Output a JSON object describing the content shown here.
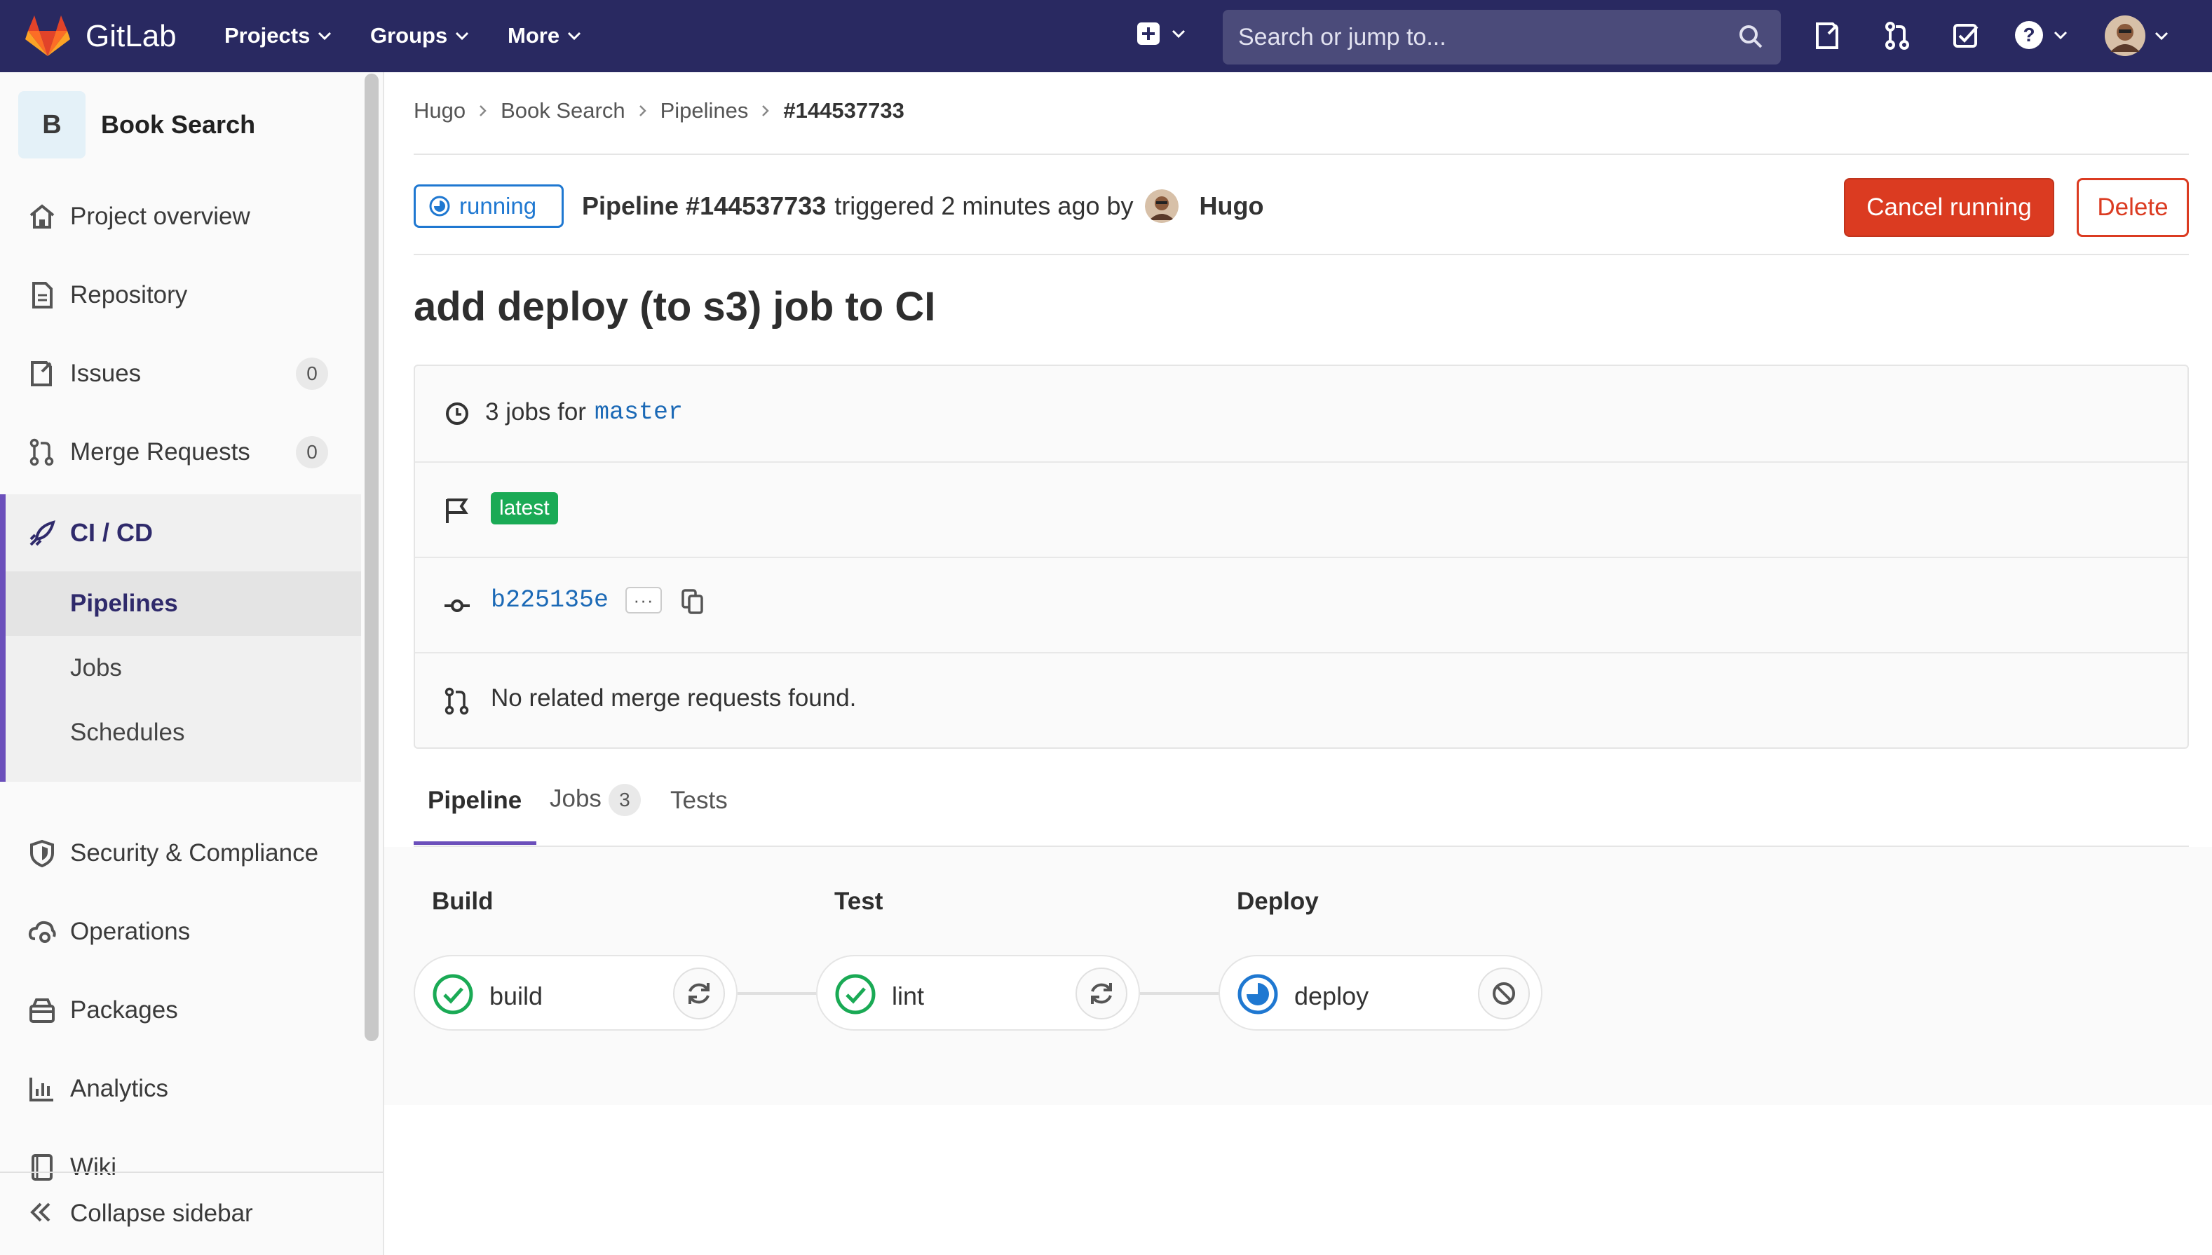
{
  "navbar": {
    "app_name": "GitLab",
    "menus": [
      "Projects",
      "Groups",
      "More"
    ],
    "search_placeholder": "Search or jump to...",
    "bg_color": "#292961"
  },
  "sidebar": {
    "project_initial": "B",
    "project_name": "Book Search",
    "items": [
      {
        "label": "Project overview",
        "icon": "home-icon"
      },
      {
        "label": "Repository",
        "icon": "document-icon"
      },
      {
        "label": "Issues",
        "icon": "issues-icon",
        "count": "0"
      },
      {
        "label": "Merge Requests",
        "icon": "merge-request-icon",
        "count": "0"
      },
      {
        "label": "CI / CD",
        "icon": "rocket-icon"
      },
      {
        "label": "Security & Compliance",
        "icon": "shield-icon"
      },
      {
        "label": "Operations",
        "icon": "cloud-gear-icon"
      },
      {
        "label": "Packages",
        "icon": "package-icon"
      },
      {
        "label": "Analytics",
        "icon": "chart-icon"
      },
      {
        "label": "Wiki",
        "icon": "book-icon"
      }
    ],
    "ci_sub": [
      "Pipelines",
      "Jobs",
      "Schedules"
    ],
    "collapse_label": "Collapse sidebar",
    "accent_color": "#6b4fbb"
  },
  "breadcrumb": [
    "Hugo",
    "Book Search",
    "Pipelines",
    "#144537733"
  ],
  "header": {
    "status": "running",
    "pipeline_label": "Pipeline #144537733",
    "triggered_text": "triggered 2 minutes ago by",
    "user": "Hugo",
    "cancel_label": "Cancel running",
    "delete_label": "Delete"
  },
  "commit_title": "add deploy (to s3) job to CI",
  "info": {
    "jobs_prefix": "3 jobs for",
    "branch": "master",
    "badge": "latest",
    "commit_sha": "b225135e",
    "ellipsis": "···",
    "merge_requests": "No related merge requests found."
  },
  "tabs": [
    {
      "label": "Pipeline"
    },
    {
      "label": "Jobs",
      "count": "3"
    },
    {
      "label": "Tests"
    }
  ],
  "stages": [
    {
      "name": "Build",
      "job": "build",
      "status": "success",
      "action": "retry"
    },
    {
      "name": "Test",
      "job": "lint",
      "status": "success",
      "action": "retry"
    },
    {
      "name": "Deploy",
      "job": "deploy",
      "status": "running",
      "action": "cancel"
    }
  ]
}
